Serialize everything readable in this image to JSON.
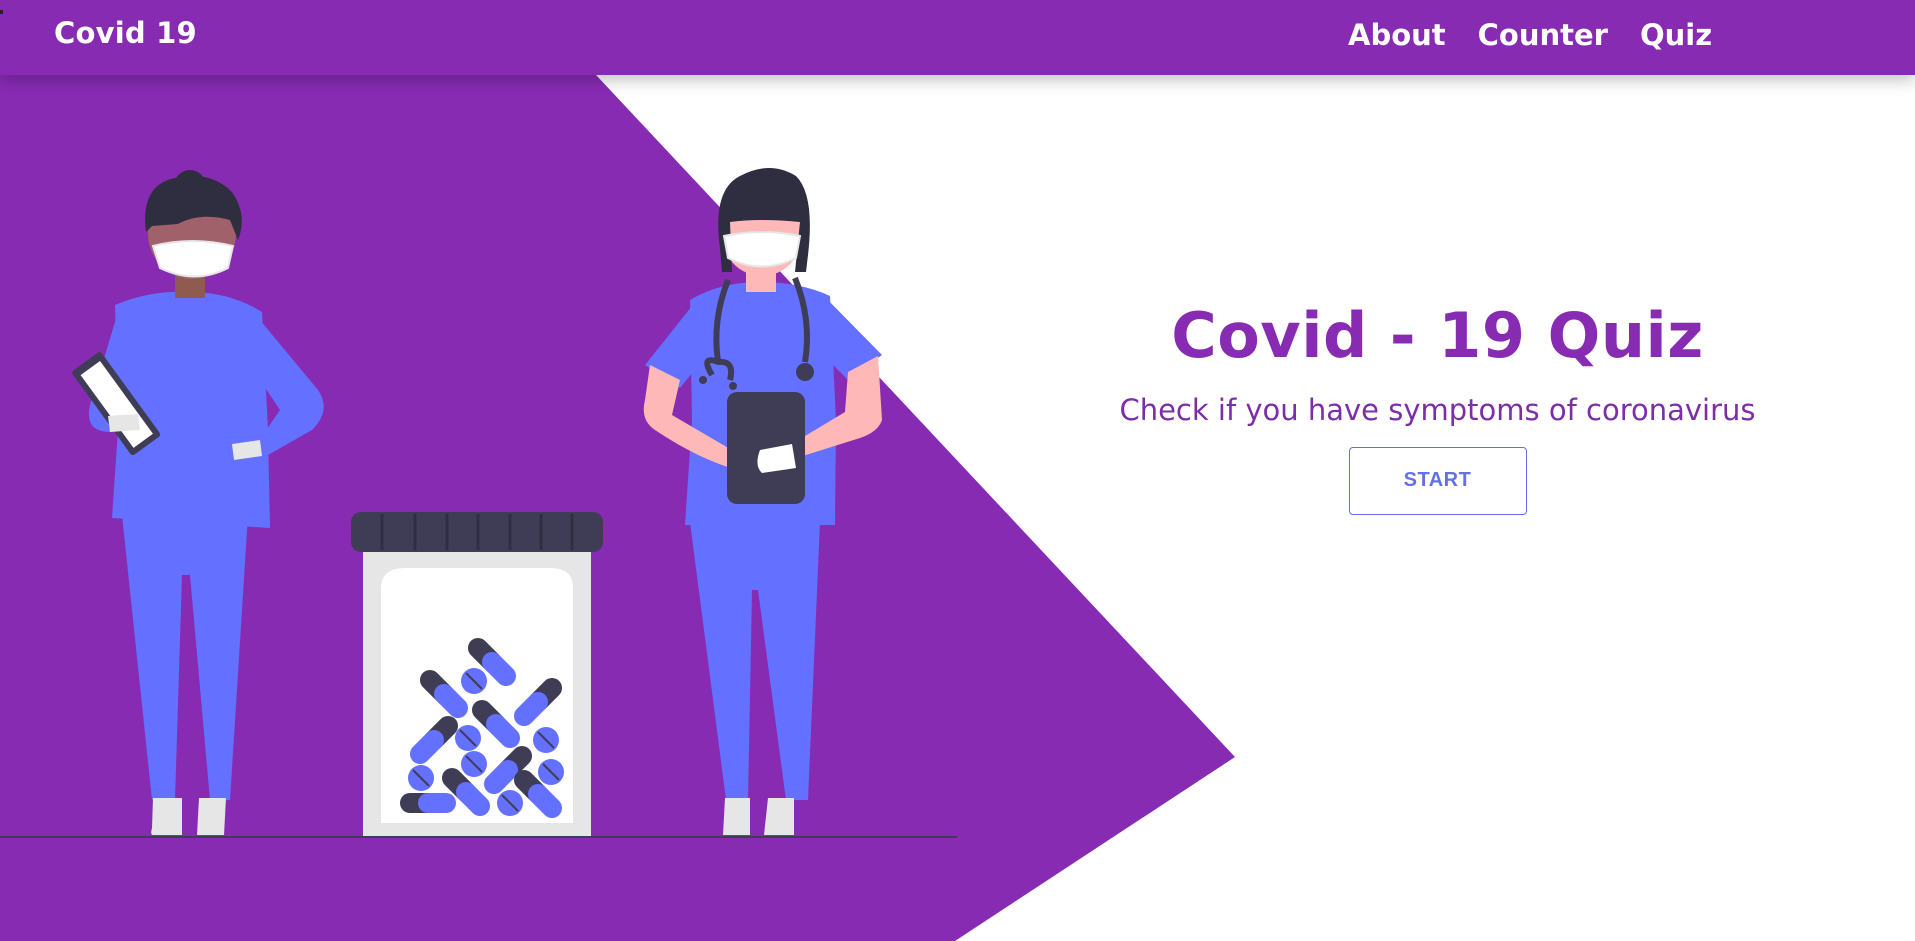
{
  "navbar": {
    "brand": "Covid 19",
    "links": [
      {
        "label": "About"
      },
      {
        "label": "Counter"
      },
      {
        "label": "Quiz"
      }
    ]
  },
  "hero": {
    "title": "Covid - 19 Quiz",
    "subtitle": "Check if you have symptoms of coronavirus",
    "start_label": "START"
  },
  "colors": {
    "brand_purple": "#872bb3",
    "accent_blue": "#6470e8",
    "scrub_blue": "#6c63ff",
    "dark": "#3f3d56",
    "background": "#ffffff"
  },
  "illustration": {
    "subjects": [
      "doctor-with-clipboard",
      "pill-bottle",
      "doctor-with-stethoscope"
    ]
  }
}
